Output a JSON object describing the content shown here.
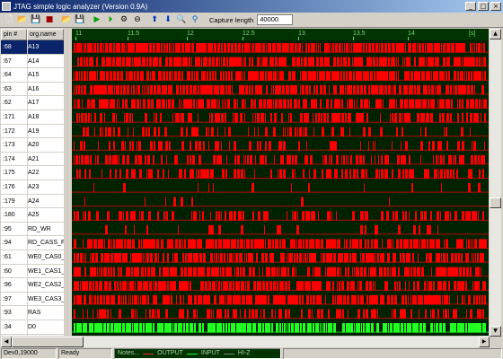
{
  "window": {
    "title": "JTAG simple logic analyzer (Version 0.9A)"
  },
  "toolbar": {
    "icons": [
      "new-file",
      "open-folder",
      "save",
      "print",
      "open-folder",
      "save",
      "run",
      "step",
      "settings",
      "stop",
      "arrow-up",
      "arrow-down",
      "zoom-in",
      "zoom-out"
    ],
    "capture_label": "Capture length",
    "capture_value": "40000"
  },
  "table": {
    "pin_header": "pin #",
    "name_header": "org.name"
  },
  "timeline": {
    "ticks": [
      "11",
      "11.5",
      "12",
      "12.5",
      "13",
      "13.5",
      "14"
    ],
    "unit": "[s]"
  },
  "signals": [
    {
      "pin": ":68",
      "name": "A13",
      "selected": true
    },
    {
      "pin": ":67",
      "name": "A14"
    },
    {
      "pin": ":64",
      "name": "A15"
    },
    {
      "pin": ":63",
      "name": "A16"
    },
    {
      "pin": ":62",
      "name": "A17"
    },
    {
      "pin": ":171",
      "name": "A18"
    },
    {
      "pin": ":172",
      "name": "A19"
    },
    {
      "pin": ":173",
      "name": "A20"
    },
    {
      "pin": ":174",
      "name": "A21"
    },
    {
      "pin": ":175",
      "name": "A22"
    },
    {
      "pin": ":176",
      "name": "A23"
    },
    {
      "pin": ":179",
      "name": "A24"
    },
    {
      "pin": ":180",
      "name": "A25"
    },
    {
      "pin": ":95",
      "name": "RD_WR"
    },
    {
      "pin": ":94",
      "name": "RD_CASS_F"
    },
    {
      "pin": ":61",
      "name": "WE0_CAS0_I"
    },
    {
      "pin": ":60",
      "name": "WE1_CAS1_I"
    },
    {
      "pin": ":96",
      "name": "WE2_CAS2_I"
    },
    {
      "pin": ":97",
      "name": "WE3_CAS3_I"
    },
    {
      "pin": ":93",
      "name": "RAS"
    },
    {
      "pin": ":34",
      "name": "D0"
    }
  ],
  "status": {
    "device": "Dev0,19000",
    "state": "Ready",
    "notes": "Notes...",
    "legend": [
      {
        "label": "OUTPUT",
        "color": "#ff2020"
      },
      {
        "label": "INPUT",
        "color": "#20ff20"
      },
      {
        "label": "HI-Z",
        "color": "#808080"
      }
    ]
  },
  "colors": {
    "output": "#ff0000",
    "input": "#22ff22",
    "background": "#002200",
    "baseline": "#7a1a1a"
  }
}
